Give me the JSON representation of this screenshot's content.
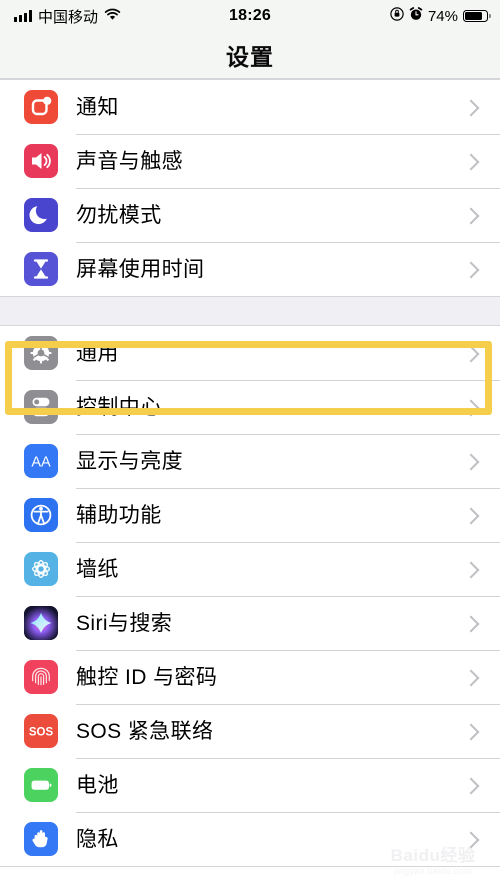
{
  "status_bar": {
    "signal_icon": "cellular-bars-icon",
    "carrier": "中国移动",
    "wifi_icon": "wifi-icon",
    "time": "18:26",
    "rotation_lock_icon": "rotation-lock-icon",
    "alarm_icon": "alarm-clock-icon",
    "battery_percent": "74%",
    "battery_level": 74,
    "battery_icon": "battery-icon"
  },
  "navbar": {
    "title": "设置"
  },
  "groups": [
    {
      "rows": [
        {
          "label": "通知",
          "icon": "notifications-icon",
          "color": "#ef4a38"
        },
        {
          "label": "声音与触感",
          "icon": "sound-haptics-icon",
          "color": "#e8395b"
        },
        {
          "label": "勿扰模式",
          "icon": "do-not-disturb-icon",
          "color": "#4a45cf"
        },
        {
          "label": "屏幕使用时间",
          "icon": "screen-time-icon",
          "color": "#5753d6"
        }
      ]
    },
    {
      "rows": [
        {
          "label": "通用",
          "icon": "general-gear-icon",
          "color": "#8e8e93",
          "highlighted": true
        },
        {
          "label": "控制中心",
          "icon": "control-center-icon",
          "color": "#8e8e93"
        },
        {
          "label": "显示与亮度",
          "icon": "display-brightness-icon",
          "color": "#3478f6"
        },
        {
          "label": "辅助功能",
          "icon": "accessibility-icon",
          "color": "#2d72f0"
        },
        {
          "label": "墙纸",
          "icon": "wallpaper-icon",
          "color": "#54b3e4"
        },
        {
          "label": "Siri与搜索",
          "icon": "siri-search-icon",
          "color": "#1b1b34"
        },
        {
          "label": "触控 ID 与密码",
          "icon": "touch-id-icon",
          "color": "#f0425c"
        },
        {
          "label": "SOS 紧急联络",
          "icon": "emergency-sos-icon",
          "color": "#eb4c3c"
        },
        {
          "label": "电池",
          "icon": "battery-settings-icon",
          "color": "#4cd25f"
        },
        {
          "label": "隐私",
          "icon": "privacy-hand-icon",
          "color": "#3478f6"
        }
      ]
    }
  ],
  "annotation": {
    "type": "highlight-rectangle",
    "color": "#f5cf4b",
    "target_label": "通用"
  },
  "watermark": {
    "main": "Baidu经验",
    "sub": "jingyan.baidu.com"
  },
  "chevron_icon": "chevron-right-icon"
}
